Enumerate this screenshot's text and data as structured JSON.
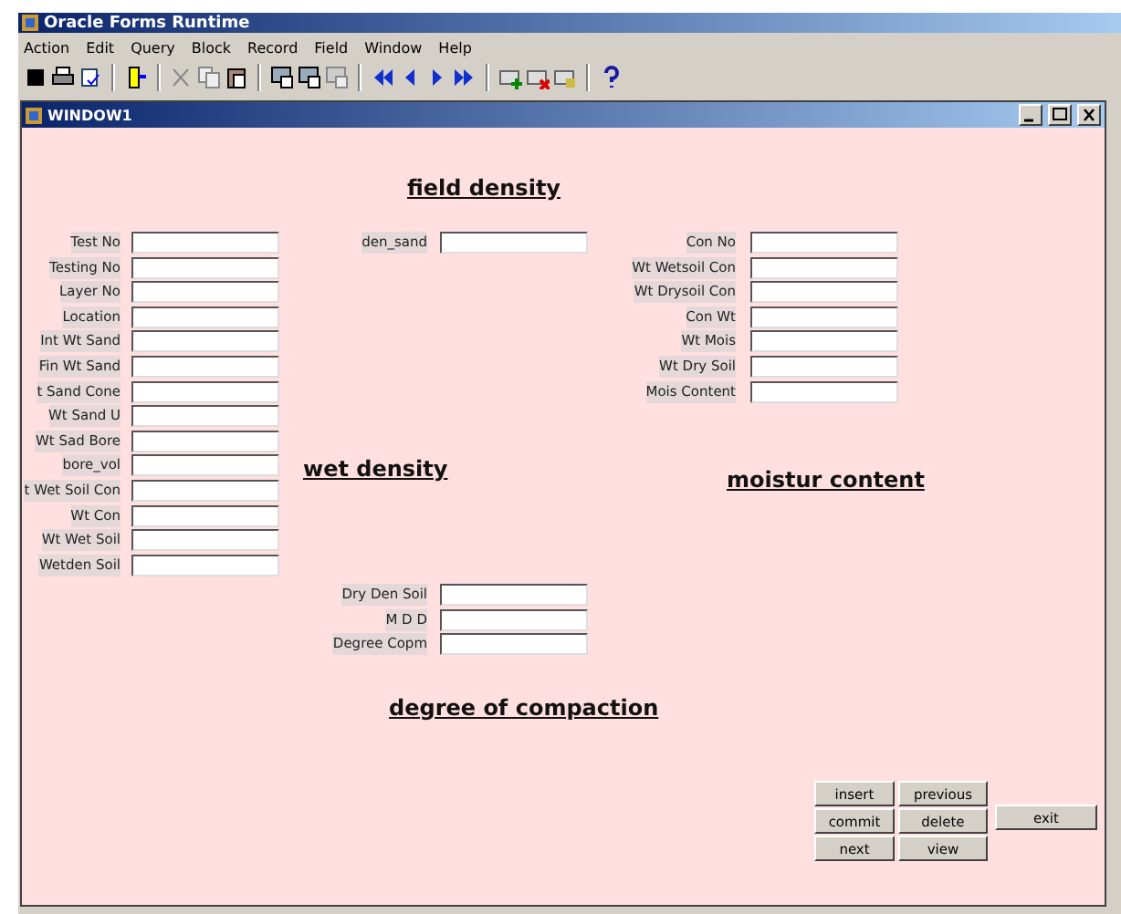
{
  "app": {
    "title": "Oracle Forms Runtime"
  },
  "menu": [
    "Action",
    "Edit",
    "Query",
    "Block",
    "Record",
    "Field",
    "Window",
    "Help"
  ],
  "window": {
    "title": "WINDOW1"
  },
  "headings": [
    {
      "kind": "field_density",
      "text": "field density"
    },
    {
      "kind": "wet_density",
      "text": "wet density"
    },
    {
      "kind": "moisture",
      "text": "moistur content"
    },
    {
      "kind": "compaction",
      "text": "degree of compaction"
    }
  ],
  "field_groups": [
    {
      "kind": "left",
      "fields": [
        "Test No",
        "Testing No",
        "Layer No",
        "Location",
        "Int Wt Sand",
        "Fin Wt Sand",
        "t Sand Cone",
        "Wt Sand U",
        "Wt Sad Bore",
        "bore_vol",
        "t Wet Soil Con",
        "Wt Con",
        "Wt Wet Soil",
        "Wetden Soil"
      ]
    },
    {
      "kind": "middle",
      "fields": [
        "den_sand"
      ]
    },
    {
      "kind": "right",
      "fields": [
        "Con No",
        "Wt Wetsoil Con",
        "Wt Drysoil Con",
        "Con Wt",
        "Wt Mois",
        "Wt Dry Soil",
        "Mois Content"
      ]
    },
    {
      "kind": "compaction",
      "fields": [
        "Dry Den Soil",
        "M D D",
        "Degree Copm"
      ]
    }
  ],
  "buttons": [
    "insert",
    "previous",
    "commit",
    "delete",
    "next",
    "view"
  ],
  "exit_button": "exit"
}
